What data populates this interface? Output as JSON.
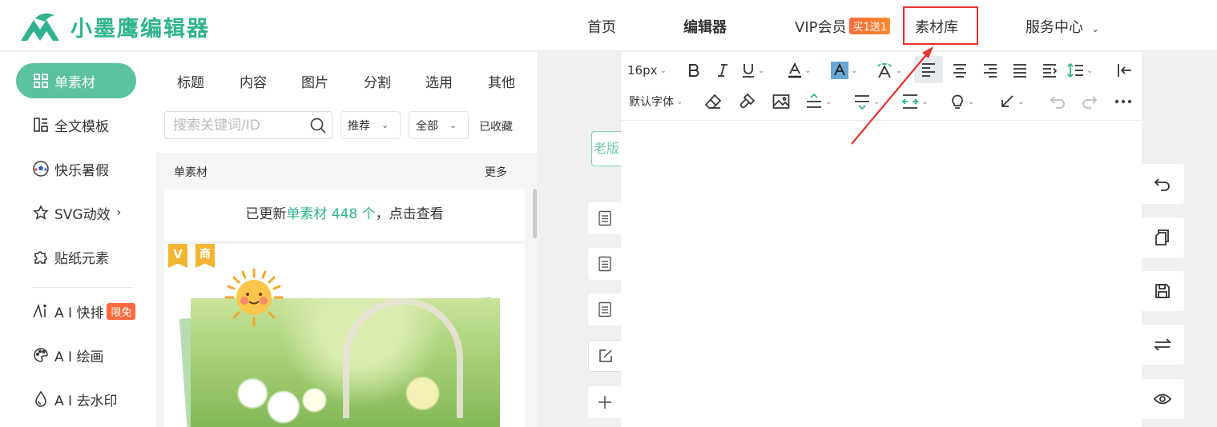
{
  "brand": {
    "name": "小墨鹰编辑器",
    "accent": "#2fb38e"
  },
  "nav": {
    "home": "首页",
    "editor": "编辑器",
    "vip": "VIP会员",
    "vip_badge": "买1送1",
    "materials": "素材库",
    "service": "服务中心"
  },
  "sidebar": {
    "items": [
      {
        "label": "单素材",
        "icon": "grid-icon",
        "active": true
      },
      {
        "label": "全文模板",
        "icon": "template-icon"
      },
      {
        "label": "快乐暑假",
        "icon": "soccer-ball-icon"
      },
      {
        "label": "SVG动效",
        "icon": "star-icon"
      },
      {
        "label": "贴纸元素",
        "icon": "puzzle-icon"
      },
      {
        "label": "A I 快排",
        "icon": "ai-icon",
        "badge": "限免"
      },
      {
        "label": "A I 绘画",
        "icon": "palette-icon"
      },
      {
        "label": "A I 去水印",
        "icon": "drop-icon"
      }
    ]
  },
  "panel": {
    "tabs": [
      "标题",
      "内容",
      "图片",
      "分割",
      "选用",
      "其他"
    ],
    "search_placeholder": "搜索关键词/ID",
    "filter_sort": "推荐",
    "filter_scope": "全部",
    "collected": "已收藏",
    "section_title": "单素材",
    "section_more": "更多",
    "update_prefix": "已更新",
    "update_link": "单素材 448 个",
    "update_suffix": "，点击查看",
    "badge_v": "V",
    "badge_shang": "商"
  },
  "editor": {
    "old_version": "老版",
    "font_size": "16px",
    "font_family": "默认字体"
  }
}
